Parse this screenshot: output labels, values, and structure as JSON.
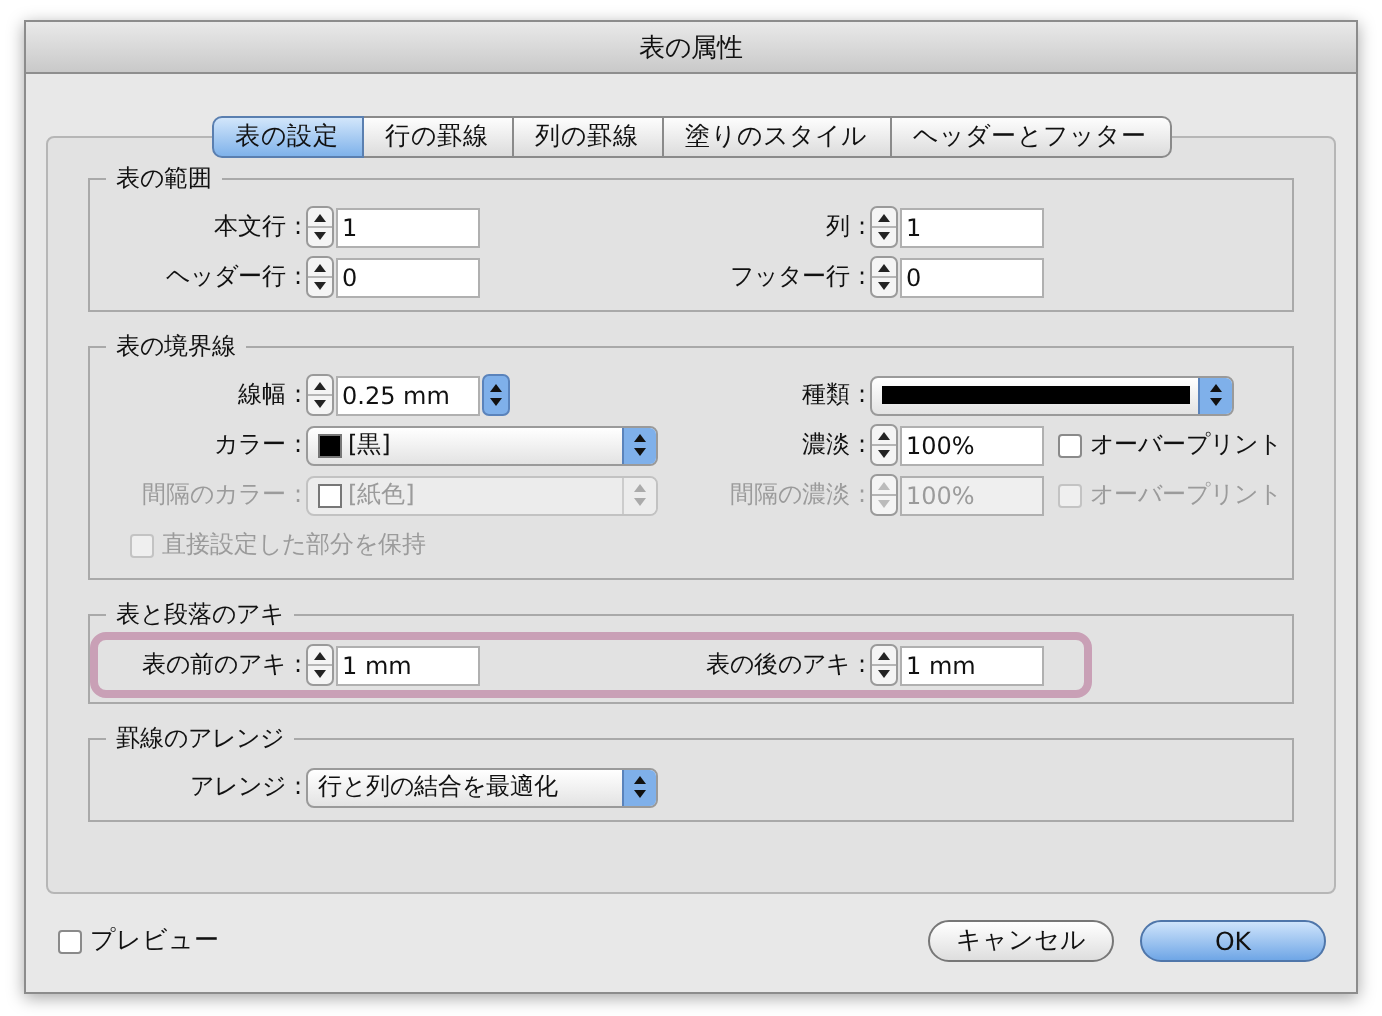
{
  "window": {
    "title": "表の属性"
  },
  "tabs": [
    {
      "label": "表の設定",
      "selected": true
    },
    {
      "label": "行の罫線",
      "selected": false
    },
    {
      "label": "列の罫線",
      "selected": false
    },
    {
      "label": "塗りのスタイル",
      "selected": false
    },
    {
      "label": "ヘッダーとフッター",
      "selected": false
    }
  ],
  "groups": [
    {
      "title": "表の範囲",
      "highlighted": false,
      "rows": [
        {
          "cells": [
            {
              "label": "本文行 :",
              "controls": [
                {
                  "kind": "spinner",
                  "value": "1",
                  "disabled": false
                }
              ]
            },
            {
              "label": "列 :",
              "controls": [
                {
                  "kind": "spinner",
                  "value": "1",
                  "disabled": false
                }
              ]
            }
          ]
        },
        {
          "cells": [
            {
              "label": "ヘッダー行 :",
              "controls": [
                {
                  "kind": "spinner",
                  "value": "0",
                  "disabled": false
                }
              ]
            },
            {
              "label": "フッター行 :",
              "controls": [
                {
                  "kind": "spinner",
                  "value": "0",
                  "disabled": false
                }
              ]
            }
          ]
        }
      ]
    },
    {
      "title": "表の境界線",
      "highlighted": false,
      "rows": [
        {
          "cells": [
            {
              "label": "線幅 :",
              "controls": [
                {
                  "kind": "unit_spinner",
                  "value": "0.25 mm",
                  "disabled": false
                }
              ]
            },
            {
              "label": "種類 :",
              "controls": [
                {
                  "kind": "stroke_dropdown",
                  "disabled": false
                }
              ]
            }
          ]
        },
        {
          "cells": [
            {
              "label": "カラー :",
              "controls": [
                {
                  "kind": "dropdown",
                  "value": "[黒]",
                  "color": "#000000",
                  "disabled": false
                }
              ]
            },
            {
              "label": "濃淡 :",
              "controls": [
                {
                  "kind": "spinner",
                  "value": "100%",
                  "disabled": false
                },
                {
                  "kind": "checkbox",
                  "label": "オーバープリント",
                  "checked": false,
                  "disabled": false
                }
              ]
            }
          ]
        },
        {
          "cells": [
            {
              "label": "間隔のカラー :",
              "disabled": true,
              "controls": [
                {
                  "kind": "dropdown",
                  "value": "[紙色]",
                  "color": "#ffffff",
                  "disabled": true
                }
              ]
            },
            {
              "label": "間隔の濃淡 :",
              "disabled": true,
              "controls": [
                {
                  "kind": "spinner",
                  "value": "100%",
                  "disabled": true
                },
                {
                  "kind": "checkbox",
                  "label": "オーバープリント",
                  "checked": false,
                  "disabled": true
                }
              ]
            }
          ]
        },
        {
          "cells": [
            {
              "controls": [
                {
                  "kind": "checkbox",
                  "label": "直接設定した部分を保持",
                  "checked": false,
                  "disabled": true
                }
              ]
            }
          ]
        }
      ]
    },
    {
      "title": "表と段落のアキ",
      "highlighted": true,
      "rows": [
        {
          "cells": [
            {
              "label": "表の前のアキ :",
              "controls": [
                {
                  "kind": "spinner",
                  "value": "1 mm",
                  "disabled": false
                }
              ]
            },
            {
              "label": "表の後のアキ :",
              "controls": [
                {
                  "kind": "spinner",
                  "value": "1 mm",
                  "disabled": false
                }
              ]
            }
          ]
        }
      ]
    },
    {
      "title": "罫線のアレンジ",
      "highlighted": false,
      "rows": [
        {
          "cells": [
            {
              "label": "アレンジ :",
              "controls": [
                {
                  "kind": "dropdown",
                  "value": "行と列の結合を最適化",
                  "disabled": false
                }
              ]
            }
          ]
        }
      ]
    }
  ],
  "preview": {
    "label": "プレビュー",
    "checked": false
  },
  "buttons": [
    {
      "label": "キャンセル",
      "kind": "normal"
    },
    {
      "label": "OK",
      "kind": "default"
    }
  ]
}
